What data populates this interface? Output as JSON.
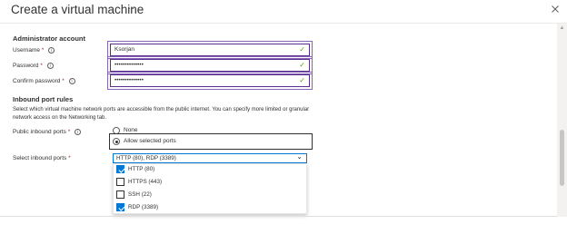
{
  "header": {
    "title": "Create a virtual machine",
    "more_label": "···"
  },
  "admin": {
    "heading": "Administrator account",
    "username_label": "Username",
    "username_value": "Ksorjan",
    "password_label": "Password",
    "password_value": "••••••••••••••",
    "confirm_label": "Confirm password",
    "confirm_value": "••••••••••••••",
    "required_mark": "*",
    "info_glyph": "i",
    "valid_glyph": "✓"
  },
  "inbound": {
    "heading": "Inbound port rules",
    "description": "Select which virtual machine network ports are accessible from the public internet. You can specify more limited or granular network access on the Networking tab.",
    "public_ports_label": "Public inbound ports",
    "options": [
      {
        "label": "None",
        "selected": false
      },
      {
        "label": "Allow selected ports",
        "selected": true
      }
    ],
    "select_ports_label": "Select inbound ports",
    "select_ports_value": "HTTP (80), RDP (3389)",
    "ports": [
      {
        "label": "HTTP (80)",
        "checked": true
      },
      {
        "label": "HTTPS (443)",
        "checked": false
      },
      {
        "label": "SSH (22)",
        "checked": false
      },
      {
        "label": "RDP (3389)",
        "checked": true
      }
    ]
  },
  "colors": {
    "accent": "#0078d4",
    "required": "#a4262c",
    "valid": "#57a300",
    "focus_frame": "#8764b8"
  },
  "icons": {
    "close": "close-icon",
    "info": "info-icon",
    "check": "check-icon",
    "chevron": "chevron-down-icon"
  }
}
